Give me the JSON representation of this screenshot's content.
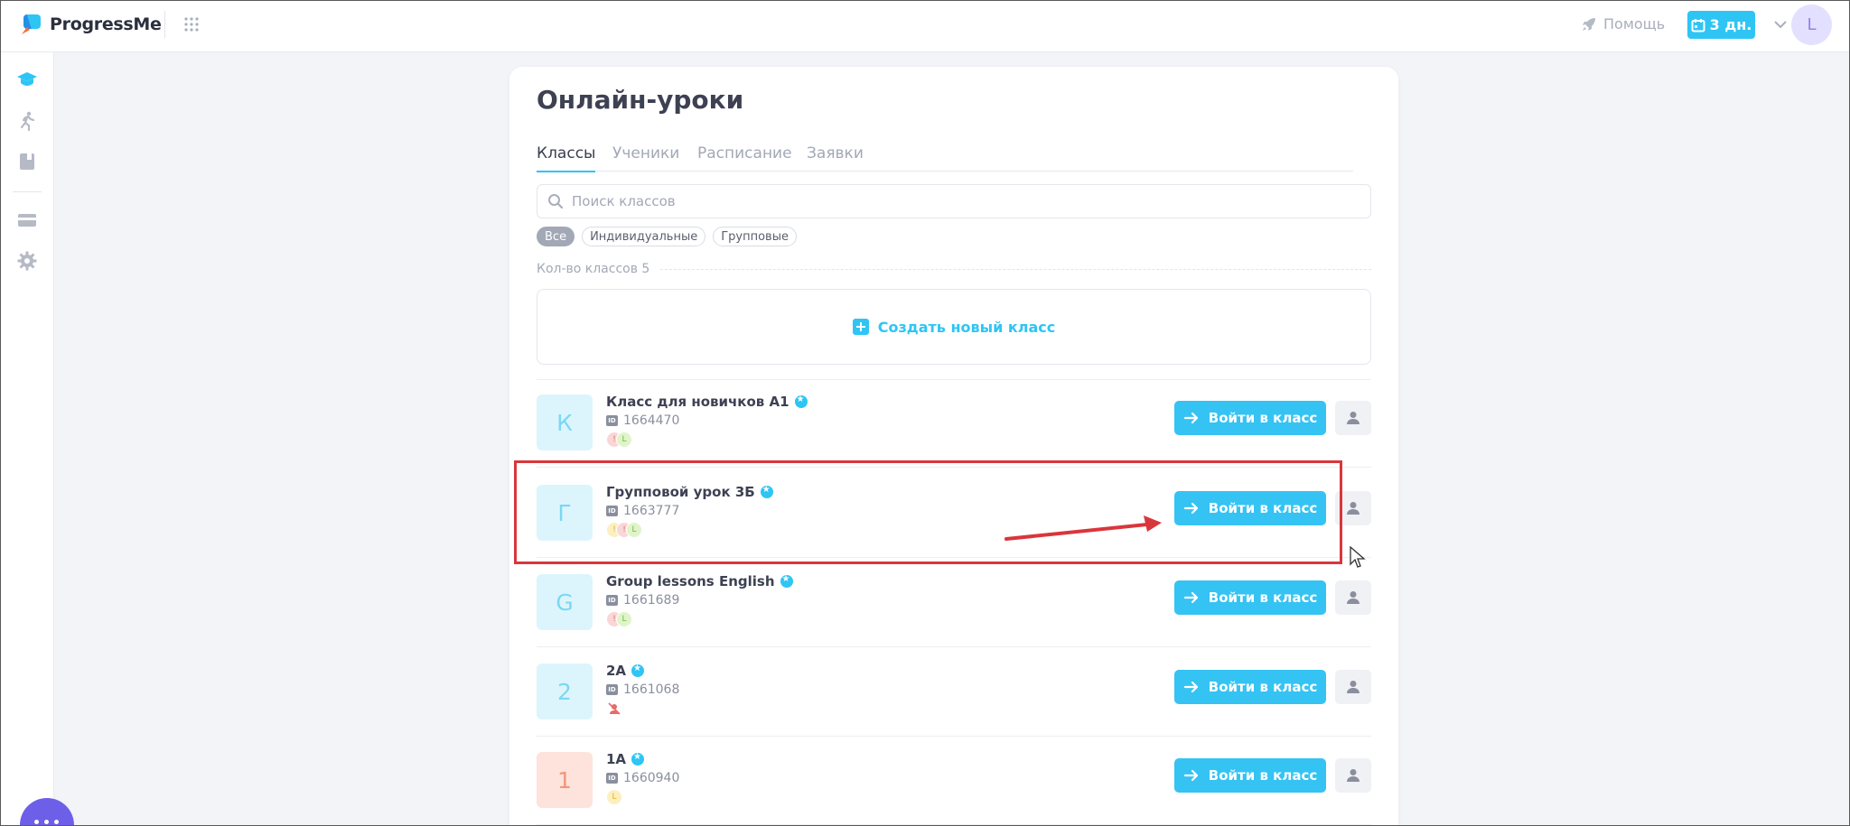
{
  "app": {
    "name": "ProgressMe"
  },
  "header": {
    "help_label": "Помощь",
    "trial_label": "3 дн.",
    "avatar_initial": "L"
  },
  "sidebar": {
    "items": [
      {
        "icon": "graduation-cap-icon",
        "active": true
      },
      {
        "icon": "running-person-icon",
        "active": false
      },
      {
        "icon": "book-icon",
        "active": false
      },
      {
        "icon": "credit-card-icon",
        "active": false
      },
      {
        "icon": "gear-icon",
        "active": false
      }
    ]
  },
  "page": {
    "title": "Онлайн-уроки",
    "tabs": [
      {
        "label": "Классы",
        "active": true
      },
      {
        "label": "Ученики",
        "active": false
      },
      {
        "label": "Расписание",
        "active": false
      },
      {
        "label": "Заявки",
        "active": false
      }
    ],
    "search_placeholder": "Поиск классов",
    "filters": [
      {
        "label": "Все",
        "active": true
      },
      {
        "label": "Индивидуальные",
        "active": false
      },
      {
        "label": "Групповые",
        "active": false
      }
    ],
    "count_label": "Кол-во классов 5",
    "create_label": "Создать новый класс",
    "enter_label": "Войти в класс"
  },
  "classes": [
    {
      "initial": "К",
      "name": "Класс для новичков A1",
      "id": "1664470",
      "color": "blue",
      "members": [
        "!",
        "L"
      ]
    },
    {
      "initial": "Г",
      "name": "Групповой урок 3Б",
      "id": "1663777",
      "color": "blue",
      "members": [
        "!",
        "!",
        "L"
      ]
    },
    {
      "initial": "G",
      "name": "Group lessons English",
      "id": "1661689",
      "color": "blue",
      "members": [
        "!",
        "L"
      ]
    },
    {
      "initial": "2",
      "name": "2А",
      "id": "1661068",
      "color": "blue",
      "members": [
        "no-users"
      ]
    },
    {
      "initial": "1",
      "name": "1А",
      "id": "1660940",
      "color": "orange",
      "members": [
        "L"
      ]
    }
  ],
  "colors": {
    "accent": "#2ec5f5",
    "highlight": "#d9363b",
    "chat": "#6e5fe8"
  }
}
